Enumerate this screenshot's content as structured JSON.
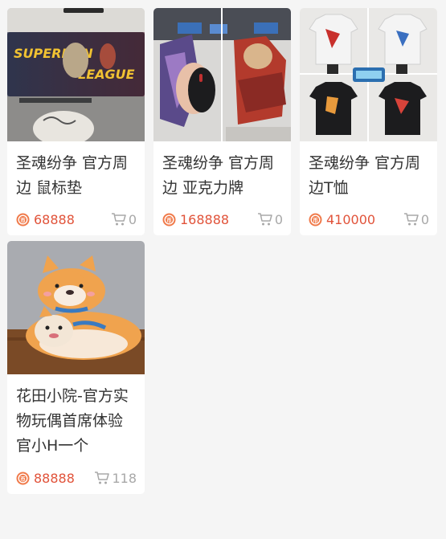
{
  "products": [
    {
      "title": "圣魂纷争 官方周边 鼠标垫",
      "price": "68888",
      "cart_count": "0",
      "image": "mousepad-photo"
    },
    {
      "title": "圣魂纷争 官方周边 亚克力牌",
      "price": "168888",
      "cart_count": "0",
      "image": "acrylic-stand-photo"
    },
    {
      "title": "圣魂纷争 官方周边T恤",
      "price": "410000",
      "cart_count": "0",
      "image": "tshirt-photo"
    },
    {
      "title": "花田小院-官方实物玩偶首席体验官小H一个",
      "price": "88888",
      "cart_count": "118",
      "image": "plush-photo"
    }
  ],
  "colors": {
    "price": "#e1533a",
    "coin": "#f07a4a",
    "muted": "#a8a8a8",
    "background": "#f5f5f5"
  }
}
